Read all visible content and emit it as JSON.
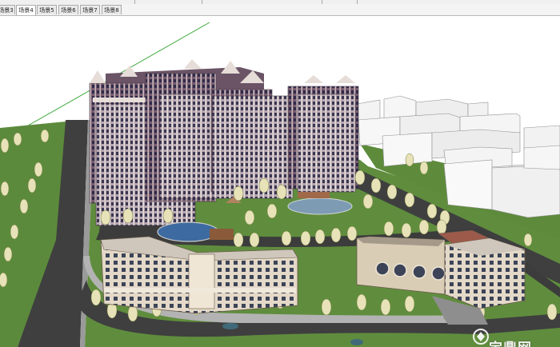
{
  "tabs": [
    {
      "label": "场景3",
      "active": false
    },
    {
      "label": "场景4",
      "active": true
    },
    {
      "label": "场景5",
      "active": false
    },
    {
      "label": "场景6",
      "active": false
    },
    {
      "label": "场景7",
      "active": false
    },
    {
      "label": "场景8",
      "active": false
    }
  ],
  "watermark": {
    "text": "定鼎网",
    "logo_icon": "dingding-logo-icon"
  },
  "colors": {
    "lawn": "#5c8a3c",
    "road": "#3f3f3f",
    "sidewalk": "#a8a8a8",
    "tower_brick": "#8a6a78",
    "tower_light": "#e6ddd8",
    "massing_block": "#f2f2f2",
    "axis_green": "#3faa3f"
  }
}
